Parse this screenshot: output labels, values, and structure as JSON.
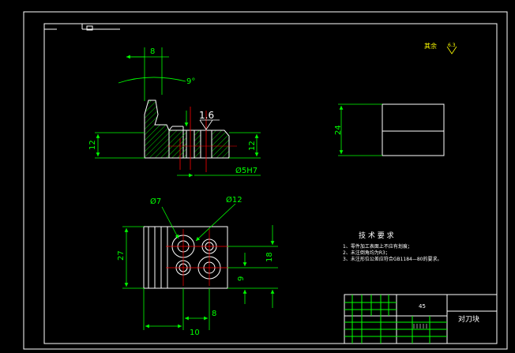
{
  "drawing": {
    "roughness_note": "其余",
    "roughness_symbol_value": "6.3",
    "surface_finish_value": "1.6",
    "dims": {
      "top_width": "8",
      "angle": "9°",
      "left_height": "12",
      "right_height": "12",
      "hole_callout": "Ø5H7",
      "side_height": "24",
      "dia_small": "Ø7",
      "dia_large": "Ø12",
      "plan_height": "27",
      "right_18": "18",
      "right_9": "9",
      "bottom_10": "10",
      "bottom_8": "8"
    },
    "tech_requirements": {
      "title": "技 术 要 求",
      "items": [
        "1、零件加工表面上不应有划痕；",
        "2、未注倒角均为R3；",
        "3、未注形位公差应符合GB1184—80的要求。"
      ]
    },
    "title_block": {
      "material": "45",
      "part_name": "对刀块"
    }
  },
  "colors": {
    "background": "#000000",
    "outline": "#ffffff",
    "dimension": "#00ff00",
    "centerline": "#ff0000",
    "hatch": "#00ff00",
    "note_text": "#ffff00"
  }
}
